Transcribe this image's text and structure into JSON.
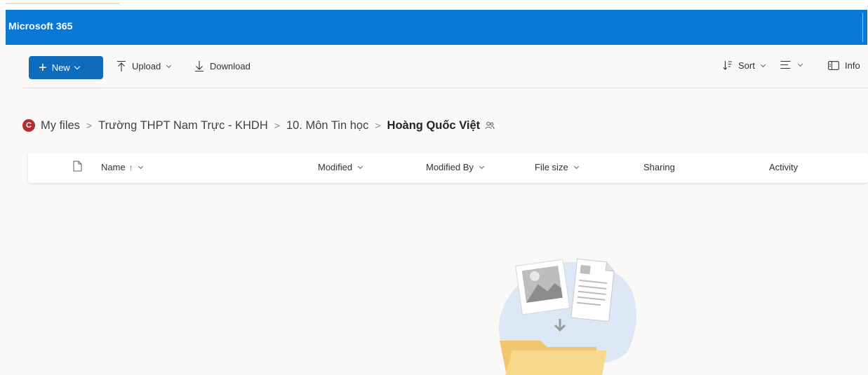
{
  "suitebar": {
    "brand": "Microsoft 365"
  },
  "commands": {
    "new_label": "New",
    "upload_label": "Upload",
    "download_label": "Download",
    "sort_label": "Sort",
    "info_label": "Info"
  },
  "breadcrumb": {
    "avatar_letter": "C",
    "items": [
      "My files",
      "Trường THPT Nam Trực - KHDH",
      "10. Môn Tin học"
    ],
    "current": "Hoàng Quốc Việt"
  },
  "columns": {
    "name": "Name",
    "name_sort_glyph": "↑",
    "modified": "Modified",
    "modified_by": "Modified By",
    "file_size": "File size",
    "sharing": "Sharing",
    "activity": "Activity"
  },
  "colors": {
    "suitebar": "#0a78d4",
    "primary_button": "#0f6cbd",
    "avatar": "#b0302e"
  },
  "icons": [
    "plus-icon",
    "upload-icon",
    "download-icon",
    "sort-icon",
    "view-options-icon",
    "info-icon",
    "shared-people-icon",
    "document-icon",
    "empty-folder-illustration"
  ]
}
